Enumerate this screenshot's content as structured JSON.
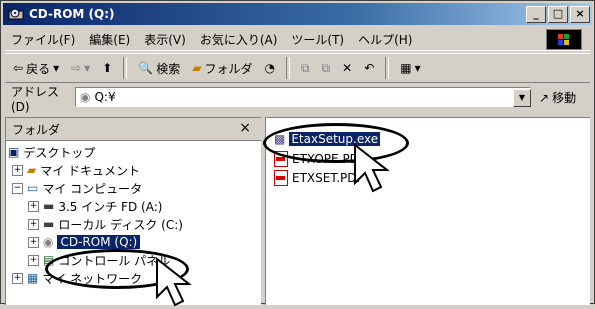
{
  "window": {
    "title": "CD-ROM (Q:)",
    "minimize": "_",
    "maximize": "□",
    "close": "×"
  },
  "menu": [
    "ファイル(F)",
    "編集(E)",
    "表示(V)",
    "お気に入り(A)",
    "ツール(T)",
    "ヘルプ(H)"
  ],
  "toolbar": {
    "back": "戻る",
    "search": "検索",
    "folders": "フォルダ"
  },
  "address": {
    "label": "アドレス(D)",
    "value": "Q:¥",
    "go": "移動"
  },
  "folders_pane": {
    "title": "フォルダ",
    "close": "×",
    "items": [
      "デスクトップ",
      "マイ ドキュメント",
      "マイ コンピュータ",
      "3.5 インチ FD (A:)",
      "ローカル ディスク (C:)",
      "CD-ROM (Q:)",
      "コントロール パネル",
      "マイ ネットワーク"
    ]
  },
  "files": [
    "EtaxSetup.exe",
    "ETXOPE.PDF",
    "ETXSET.PDF"
  ],
  "colors": {
    "title_start": "#0a246a",
    "title_end": "#a6caf0",
    "selection": "#0a246a"
  }
}
